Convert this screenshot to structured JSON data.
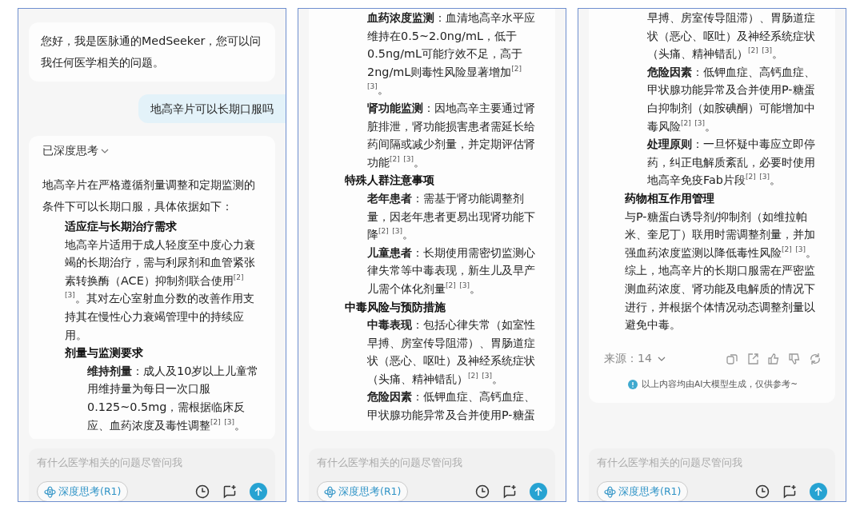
{
  "panels": [
    {
      "greeting": {
        "text": "您好，我是医脉通的MedSeeker，您可以问我任何医学相关的问题。"
      },
      "user_message": {
        "text": "地高辛片可以长期口服吗"
      },
      "answer": {
        "thinking_toggle": {
          "label": "已深度思考",
          "expanded": false
        },
        "intro": "地高辛片在严格遵循剂量调整和定期监测的条件下可以长期口服，具体依据如下：",
        "sections": [
          {
            "heading": "适应症与长期治疗需求",
            "body": "地高辛片适用于成人轻度至中度心力衰竭的长期治疗，需与利尿剂和血管紧张素转换酶（ACE）抑制剂联合使用$^{[2]}$ $^{[3]}$。其对左心室射血分数的改善作用支持其在慢性心力衰竭管理中的持续应用。"
          },
          {
            "heading": "剂量与监测要求",
            "items": [
              "**维持剂量**：成人及10岁以上儿童常用维持量为每日一次口服0.125~0.5mg，需根据临床反应、血药浓度及毒性调整$^{[2]}$ $^{[3]}$。"
            ]
          }
        ]
      },
      "composer": {
        "placeholder": "有什么医学相关的问题尽管问我",
        "deep_think_button": {
          "label": "深度思考(R1)"
        }
      }
    },
    {
      "answer": {
        "sections": [
          {
            "items": [
              "**血药浓度监测**：血清地高辛水平应维持在0.5~2.0ng/mL，低于0.5ng/mL可能疗效不足，高于2ng/mL则毒性风险显著增加$^{[2]}$ $^{[3]}$。",
              "**肾功能监测**：因地高辛主要通过肾脏排泄，肾功能损害患者需延长给药间隔或减少剂量，并定期评估肾功能$^{[2]}$ $^{[3]}$。"
            ]
          },
          {
            "heading": "特殊人群注意事项",
            "items": [
              "**老年患者**：需基于肾功能调整剂量，因老年患者更易出现肾功能下降$^{[2]}$ $^{[3]}$。",
              "**儿童患者**：长期使用需密切监测心律失常等中毒表现，新生儿及早产儿需个体化剂量$^{[2]}$ $^{[3]}$。"
            ]
          },
          {
            "heading": "中毒风险与预防措施",
            "items": [
              "**中毒表现**：包括心律失常（如室性早搏、房室传导阻滞）、胃肠道症状（恶心、呕吐）及神经系统症状（头痛、精神错乱）$^{[2]}$ $^{[3]}$。",
              "**危险因素**：低钾血症、高钙血症、甲状腺功能异常及合并使用P-糖蛋"
            ]
          }
        ]
      },
      "composer": {
        "placeholder": "有什么医学相关的问题尽管问我",
        "deep_think_button": {
          "label": "深度思考(R1)"
        }
      }
    },
    {
      "answer": {
        "sections": [
          {
            "items": [
              "早搏、房室传导阻滞）、胃肠道症状（恶心、呕吐）及神经系统症状（头痛、精神错乱）$^{[2]}$ $^{[3]}$。",
              "**危险因素**：低钾血症、高钙血症、甲状腺功能异常及合并使用P-糖蛋白抑制剂（如胺碘酮）可能增加中毒风险$^{[2]}$ $^{[3]}$。",
              "**处理原则**：一旦怀疑中毒应立即停药，纠正电解质紊乱，必要时使用地高辛免疫Fab片段$^{[2]}$ $^{[3]}$。"
            ]
          },
          {
            "heading": "药物相互作用管理",
            "body": "与P-糖蛋白诱导剂/抑制剂（如维拉帕米、奎尼丁）联用时需调整剂量，并加强血药浓度监测以降低毒性风险$^{[2]}$ $^{[3]}$。"
          },
          {
            "body": "综上，地高辛片的长期口服需在严密监测血药浓度、肾功能及电解质的情况下进行，并根据个体情况动态调整剂量以避免中毒。"
          }
        ],
        "sources": {
          "label": "来源：14"
        },
        "disclaimer": "以上内容均由AI大模型生成，仅供参考~"
      },
      "composer": {
        "placeholder": "有什么医学相关的问题尽管问我",
        "deep_think_button": {
          "label": "深度思考(R1)"
        }
      }
    }
  ]
}
